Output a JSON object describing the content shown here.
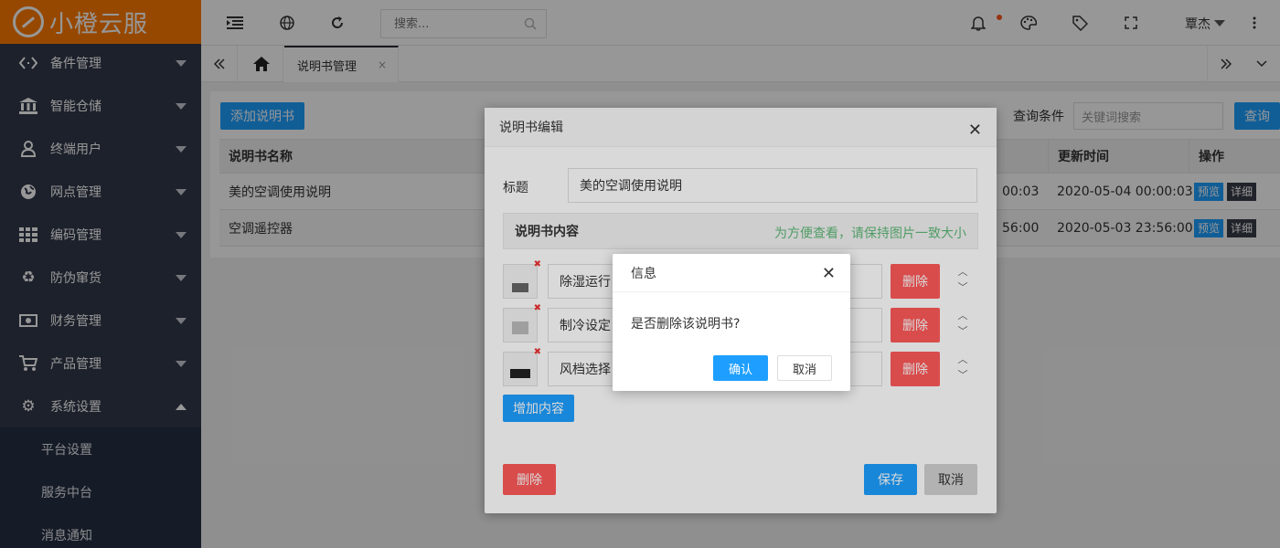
{
  "app": {
    "logo_text": "小橙云服"
  },
  "sidebar": {
    "items": [
      {
        "label": "备件管理",
        "icon": "code-brackets-icon"
      },
      {
        "label": "智能仓储",
        "icon": "bank-icon"
      },
      {
        "label": "终端用户",
        "icon": "user-icon"
      },
      {
        "label": "网点管理",
        "icon": "globe-icon"
      },
      {
        "label": "编码管理",
        "icon": "grid-icon"
      },
      {
        "label": "防伪窜货",
        "icon": "recycle-icon"
      },
      {
        "label": "财务管理",
        "icon": "money-icon"
      },
      {
        "label": "产品管理",
        "icon": "cart-icon"
      },
      {
        "label": "系统设置",
        "icon": "gear-icon"
      }
    ],
    "sub_items": [
      {
        "label": "平台设置"
      },
      {
        "label": "服务中台"
      },
      {
        "label": "消息通知"
      }
    ]
  },
  "topbar": {
    "search_placeholder": "搜索...",
    "user_name": "覃杰"
  },
  "tabs": {
    "active_label": "说明书管理",
    "close_glyph": "×"
  },
  "page": {
    "add_button": "添加说明书",
    "query_label": "查询条件",
    "query_placeholder": "关键词搜索",
    "query_button": "查询",
    "columns": {
      "name": "说明书名称",
      "update_time": "更新时间",
      "actions": "操作"
    },
    "rows": [
      {
        "name": "美的空调使用说明",
        "create_time_partial": "00:03",
        "update_time": "2020-05-04 00:00:03",
        "preview": "预览",
        "detail": "详细"
      },
      {
        "name": "空调遥控器",
        "create_time_partial": "56:00",
        "update_time": "2020-05-03 23:56:00",
        "preview": "预览",
        "detail": "详细"
      }
    ]
  },
  "edit_modal": {
    "title": "说明书编辑",
    "title_label": "标题",
    "title_value": "美的空调使用说明",
    "content_section": "说明书内容",
    "content_note": "为方便查看，请保持图片一致大小",
    "content_rows": [
      {
        "text": "除湿运行",
        "delete": "删除"
      },
      {
        "text": "制冷设定",
        "delete": "删除"
      },
      {
        "text": "风档选择",
        "delete": "删除"
      }
    ],
    "add_content": "增加内容",
    "delete_button": "删除",
    "save_button": "保存",
    "cancel_button": "取消"
  },
  "confirm": {
    "title": "信息",
    "message": "是否删除该说明书?",
    "ok": "确认",
    "cancel": "取消"
  },
  "colors": {
    "brand": "#ff7a00",
    "sidebar_bg": "#30394a",
    "primary": "#1e9fff",
    "danger": "#ff5a5a",
    "success_text": "#5fb878"
  }
}
